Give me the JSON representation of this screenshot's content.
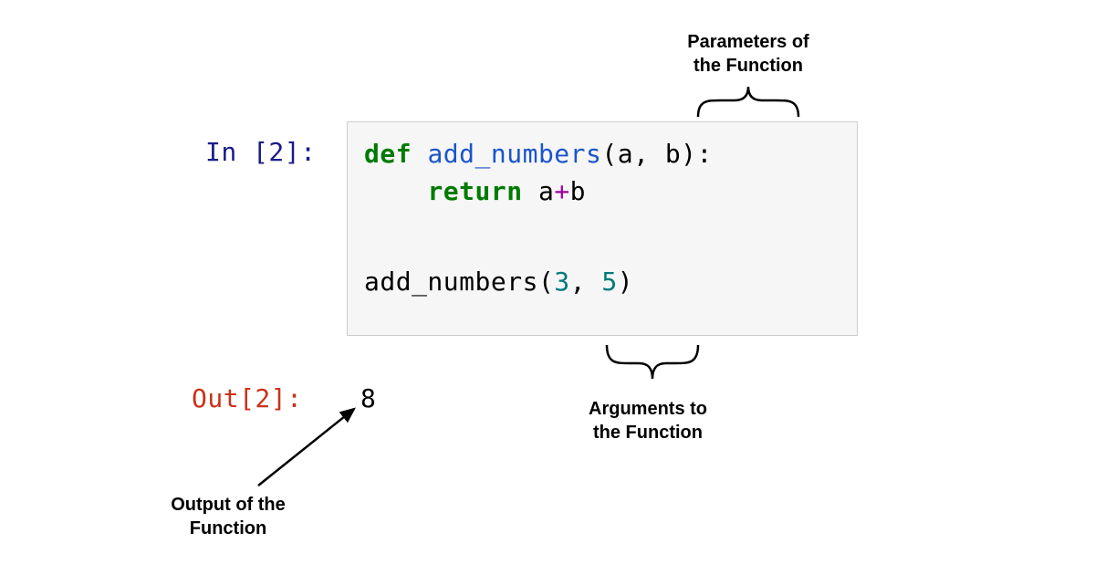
{
  "prompt": {
    "in_label": "In [2]:",
    "out_label": "Out[2]:"
  },
  "code": {
    "line1_kw": "def",
    "line1_fn": "add_numbers",
    "line1_params_open": "(",
    "line1_param_a": "a",
    "line1_comma": ", ",
    "line1_param_b": "b",
    "line1_params_close": "):",
    "line2_indent": "    ",
    "line2_kw": "return",
    "line2_space": " ",
    "line2_var_a": "a",
    "line2_op": "+",
    "line2_var_b": "b",
    "line3": "",
    "line4_call": "add_numbers",
    "line4_open": "(",
    "line4_arg1": "3",
    "line4_comma": ", ",
    "line4_arg2": "5",
    "line4_close": ")"
  },
  "output": {
    "value": "8"
  },
  "annotations": {
    "params_l1": "Parameters of",
    "params_l2": "the Function",
    "args_l1": "Arguments to",
    "args_l2": "the Function",
    "output_l1": "Output of the",
    "output_l2": "Function"
  }
}
